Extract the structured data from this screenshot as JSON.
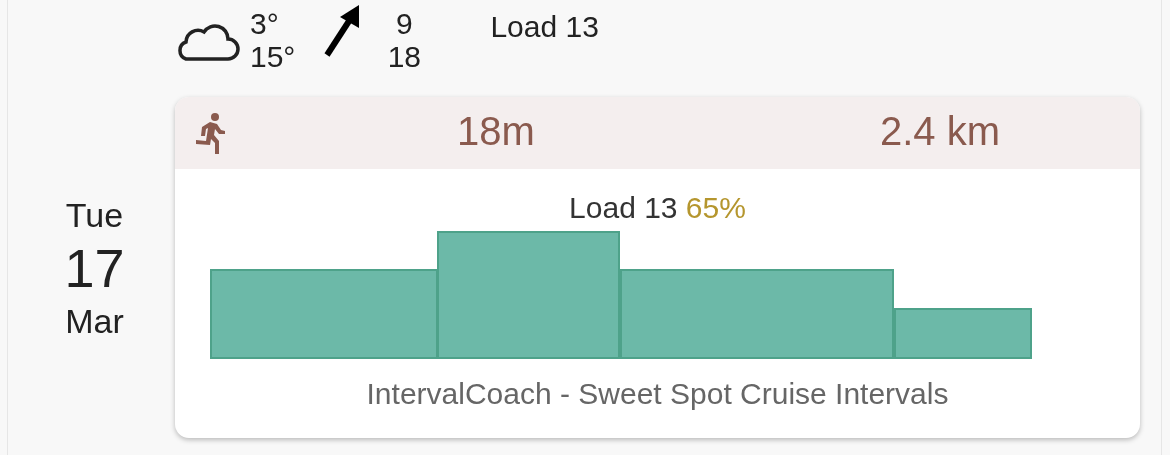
{
  "date": {
    "weekday": "Tue",
    "day": "17",
    "month": "Mar"
  },
  "weather": {
    "temp_low": "3°",
    "temp_high": "15°",
    "wind_low": "9",
    "wind_high": "18",
    "load": "Load 13"
  },
  "activity": {
    "duration": "18m",
    "distance": "2.4 km",
    "load_label": "Load 13",
    "load_percent": "65%",
    "workout_name": "IntervalCoach - Sweet Spot Cruise Intervals"
  }
}
